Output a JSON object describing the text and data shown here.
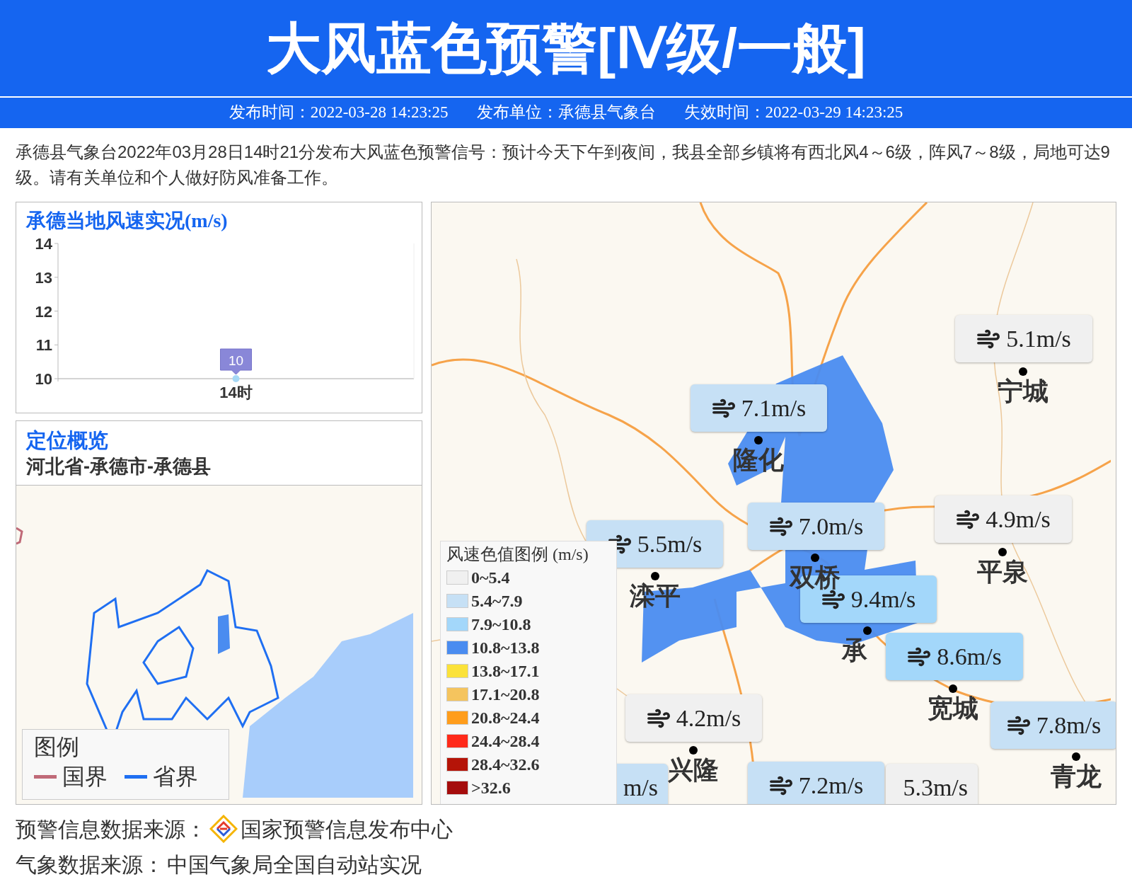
{
  "header": {
    "title": "大风蓝色预警[Ⅳ级/一般]"
  },
  "info_bar": [
    "发布时间：2022-03-28 14:23:25",
    "发布单位：承德县气象台",
    "失效时间：2022-03-29 14:23:25"
  ],
  "description": "承德县气象台2022年03月28日14时21分发布大风蓝色预警信号：预计今天下午到夜间，我县全部乡镇将有西北风4～6级，阵风7～8级，局地可达9级。请有关单位和个人做好防风准备工作。",
  "wind_chart": {
    "title": "承德当地风速实况(m/s)",
    "chart_data": {
      "type": "line",
      "categories": [
        "14时"
      ],
      "series": [
        {
          "color": "#a6d8f5",
          "marker": true,
          "values": [
            10
          ]
        }
      ],
      "ylim": [
        10,
        14
      ],
      "yticks": [
        10,
        11,
        12,
        13,
        14
      ],
      "data_labels": true
    }
  },
  "location": {
    "title": "定位概览",
    "path": "河北省-承德市-承德县",
    "legend": {
      "title": "图例",
      "items": [
        {
          "label": "国界",
          "color": "#c06a78"
        },
        {
          "label": "省界",
          "color": "#1f6ff2"
        }
      ]
    }
  },
  "wind_map": {
    "readings": [
      {
        "text": "5.5m/s",
        "color": "#c6e0f5",
        "icon": true
      },
      {
        "text": "m/s",
        "color": "#c6e0f5",
        "icon": false
      },
      {
        "text": "5.1m/s",
        "color": "#f0f0f0",
        "icon": true
      },
      {
        "text": "7.1m/s",
        "color": "#c6e0f5",
        "icon": true
      },
      {
        "text": "7.0m/s",
        "color": "#c6e0f5",
        "icon": true
      },
      {
        "text": "4.9m/s",
        "color": "#f0f0f0",
        "icon": true
      },
      {
        "text": "9.4m/s",
        "color": "#a3d7fa",
        "icon": true
      },
      {
        "text": "8.6m/s",
        "color": "#a3d7fa",
        "icon": true
      },
      {
        "text": "4.2m/s",
        "color": "#f0f0f0",
        "icon": true
      },
      {
        "text": "7.8m/s",
        "color": "#c6e0f5",
        "icon": true
      },
      {
        "text": "7.2m/s",
        "color": "#c6e0f5",
        "icon": true
      },
      {
        "text": "5.3m/s",
        "color": "#f0f0f0",
        "icon": false
      }
    ],
    "stations": [
      "宁城",
      "隆化",
      "滦平",
      "双桥",
      "平泉",
      "承",
      "宽城",
      "兴隆",
      "青龙"
    ],
    "legend": {
      "title": "风速色值图例 (m/s)",
      "items": [
        {
          "label": "0~5.4",
          "color": "#f0f0f0"
        },
        {
          "label": "5.4~7.9",
          "color": "#c6e0f5"
        },
        {
          "label": "7.9~10.8",
          "color": "#a3d7fa"
        },
        {
          "label": "10.8~13.8",
          "color": "#4a8cf0"
        },
        {
          "label": "13.8~17.1",
          "color": "#fbe23a"
        },
        {
          "label": "17.1~20.8",
          "color": "#f5c45e"
        },
        {
          "label": "20.8~24.4",
          "color": "#ff9d1c"
        },
        {
          "label": "24.4~28.4",
          "color": "#ff2a1a"
        },
        {
          "label": "28.4~32.6",
          "color": "#b51408"
        },
        {
          "label": ">32.6",
          "color": "#a50c0c"
        }
      ]
    }
  },
  "footer": [
    {
      "label": "预警信息数据来源：",
      "source": "国家预警信息发布中心",
      "logo": true
    },
    {
      "label": "气象数据来源：",
      "source": "中国气象局全国自动站实况",
      "logo": false
    }
  ]
}
